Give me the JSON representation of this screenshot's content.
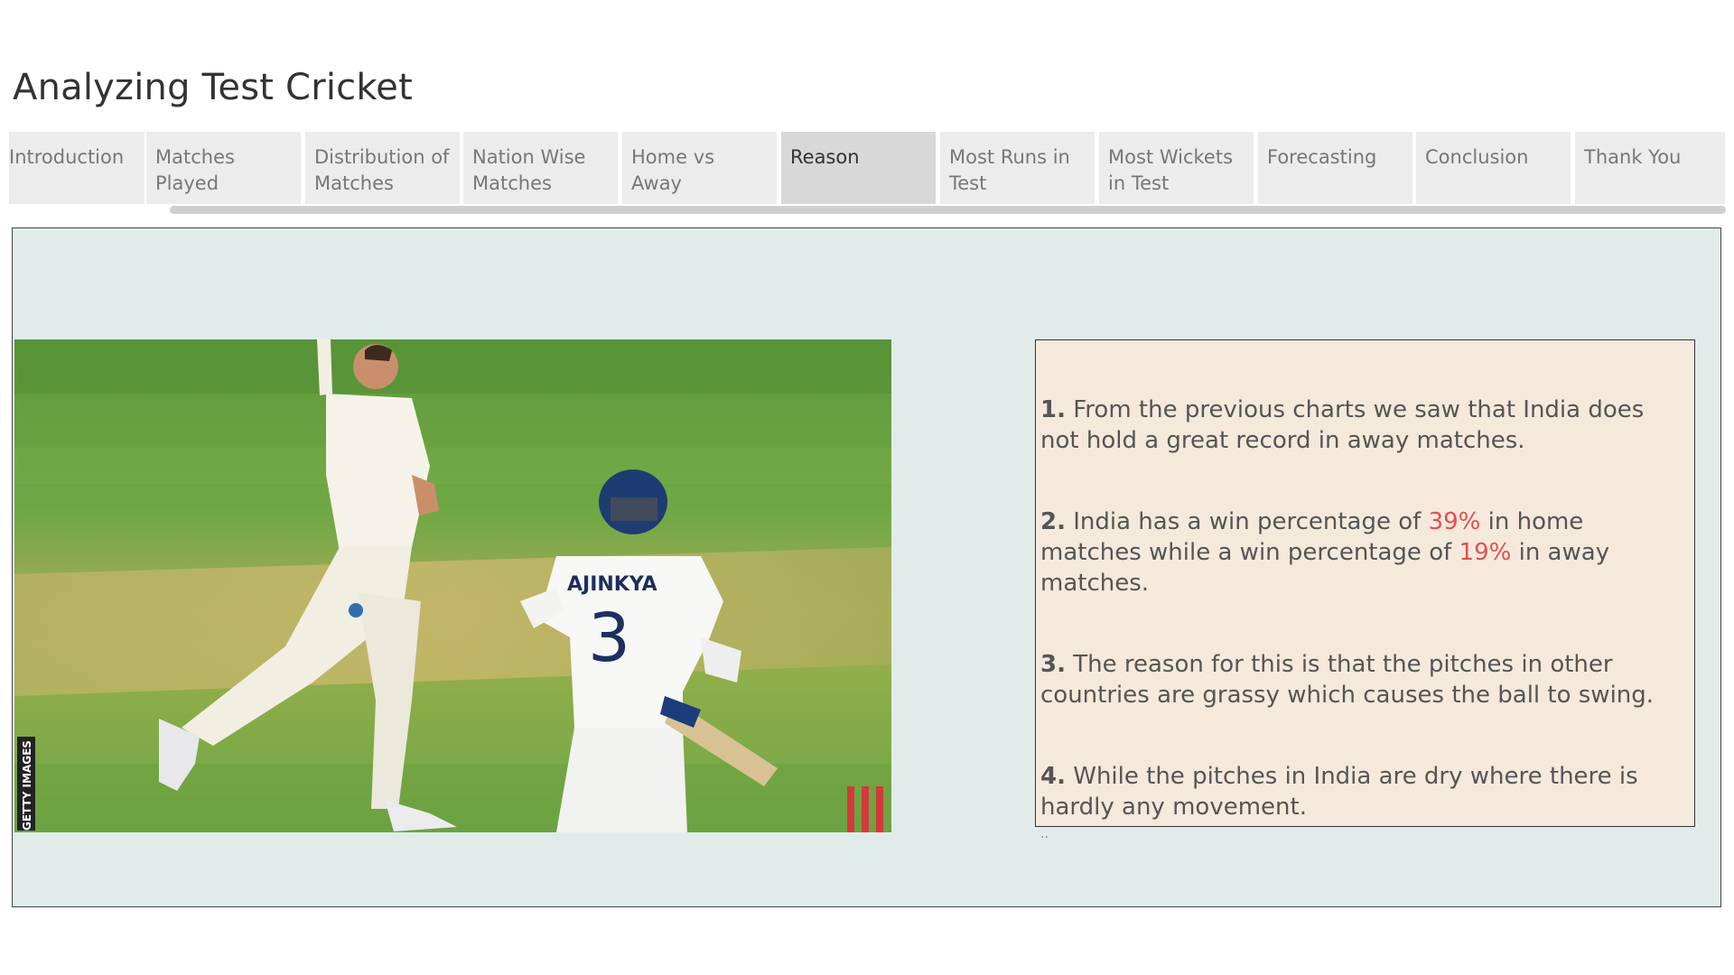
{
  "title": "Analyzing Test Cricket",
  "tabs": [
    {
      "label": "Introduction",
      "active": false
    },
    {
      "label": "Matches Played",
      "active": false
    },
    {
      "label": "Distribution of Matches",
      "active": false
    },
    {
      "label": "Nation Wise Matches",
      "active": false
    },
    {
      "label": "Home vs Away",
      "active": false
    },
    {
      "label": "Reason",
      "active": true
    },
    {
      "label": "Most Runs in Test",
      "active": false
    },
    {
      "label": "Most Wickets in Test",
      "active": false
    },
    {
      "label": "Forecasting",
      "active": false
    },
    {
      "label": "Conclusion",
      "active": false
    },
    {
      "label": "Thank You",
      "active": false
    }
  ],
  "photo": {
    "jersey_name": "AJINKYA",
    "jersey_number": "3",
    "credit": "GETTY IMAGES"
  },
  "points": [
    {
      "num": "1.",
      "text": "From the previous charts we saw that India does not hold a great record in away matches."
    },
    {
      "num": "2.",
      "pre": "India has a win percentage of",
      "home_pct": "39%",
      "mid": "in home matches while a win percentage of",
      "away_pct": "19%",
      "post": "in away matches."
    },
    {
      "num": "3.",
      "text": "The reason for this is that the pitches in other countries are grassy which causes the ball to swing."
    },
    {
      "num": "4.",
      "text": "While the pitches in India are dry where there is hardly any movement."
    }
  ],
  "trailing": "..",
  "colors": {
    "highlight": "#e05050",
    "panel_bg": "#e1ecea",
    "note_bg": "#f5e9dc",
    "tab_bg": "#ececec",
    "tab_active_bg": "#d8d8d8"
  }
}
